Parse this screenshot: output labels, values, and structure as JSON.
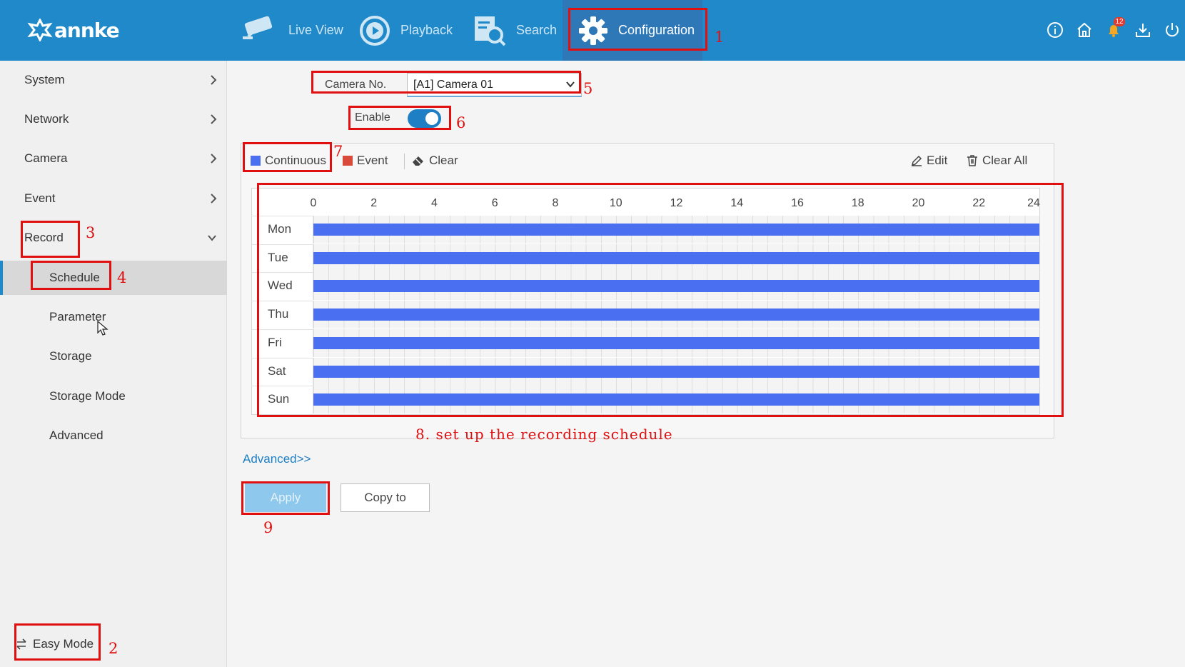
{
  "header": {
    "brand": "annke",
    "nav": [
      {
        "label": "Live View",
        "icon": "camera-icon",
        "active": false
      },
      {
        "label": "Playback",
        "icon": "playback-icon",
        "active": false
      },
      {
        "label": "Search",
        "icon": "search-icon",
        "active": false
      },
      {
        "label": "Configuration",
        "icon": "gear-icon",
        "active": true
      }
    ],
    "notification_count": "12",
    "right_icons": [
      "info-icon",
      "home-icon",
      "bell-icon",
      "download-icon",
      "power-icon"
    ]
  },
  "sidebar": {
    "menu": [
      {
        "label": "System",
        "expanded": false
      },
      {
        "label": "Network",
        "expanded": false
      },
      {
        "label": "Camera",
        "expanded": false
      },
      {
        "label": "Event",
        "expanded": false
      },
      {
        "label": "Record",
        "expanded": true
      }
    ],
    "record_submenu": [
      {
        "label": "Schedule",
        "active": true
      },
      {
        "label": "Parameter",
        "active": false
      },
      {
        "label": "Storage",
        "active": false
      },
      {
        "label": "Storage Mode",
        "active": false
      },
      {
        "label": "Advanced",
        "active": false
      }
    ],
    "easy_mode": "Easy Mode"
  },
  "main": {
    "camera_label": "Camera No.",
    "camera_value": "[A1] Camera 01",
    "enable_label": "Enable",
    "enable_on": true,
    "toolbar": {
      "continuous": "Continuous",
      "event": "Event",
      "clear": "Clear",
      "edit": "Edit",
      "clear_all": "Clear All"
    },
    "colors": {
      "continuous": "#4a6ff0",
      "event": "#d84a3a",
      "accent": "#1f89c9",
      "annotation": "#e01010"
    },
    "schedule": {
      "hours": [
        "0",
        "2",
        "4",
        "6",
        "8",
        "10",
        "12",
        "14",
        "16",
        "18",
        "20",
        "22",
        "24"
      ],
      "days": [
        {
          "name": "Mon",
          "type": "Continuous",
          "start": 0,
          "end": 24
        },
        {
          "name": "Tue",
          "type": "Continuous",
          "start": 0,
          "end": 24
        },
        {
          "name": "Wed",
          "type": "Continuous",
          "start": 0,
          "end": 24
        },
        {
          "name": "Thu",
          "type": "Continuous",
          "start": 0,
          "end": 24
        },
        {
          "name": "Fri",
          "type": "Continuous",
          "start": 0,
          "end": 24
        },
        {
          "name": "Sat",
          "type": "Continuous",
          "start": 0,
          "end": 24
        },
        {
          "name": "Sun",
          "type": "Continuous",
          "start": 0,
          "end": 24
        }
      ]
    },
    "advanced_link": "Advanced>>",
    "apply_label": "Apply",
    "copy_label": "Copy to"
  },
  "annotations": {
    "numbers": [
      "1",
      "2",
      "3",
      "4",
      "5",
      "6",
      "7",
      "9"
    ],
    "caption": "8. set up the recording schedule"
  }
}
